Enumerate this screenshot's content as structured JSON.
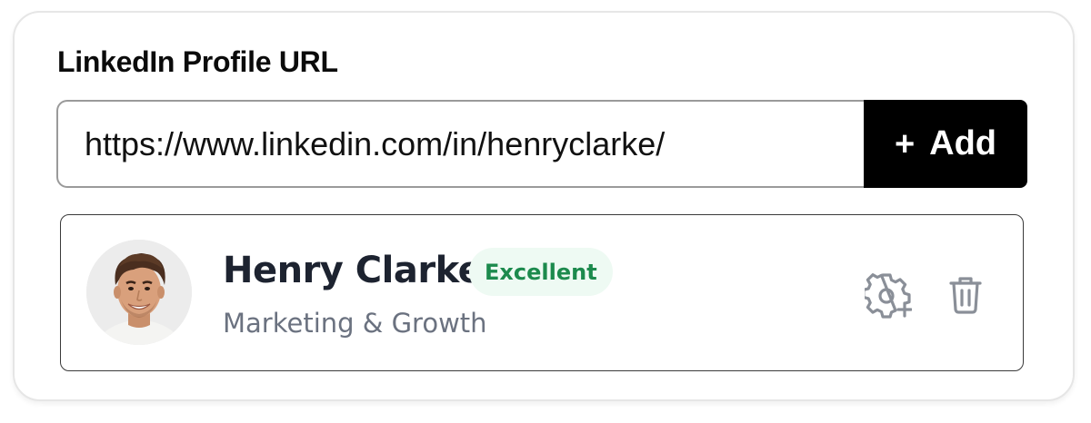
{
  "form": {
    "label": "LinkedIn Profile URL",
    "url_value": "https://www.linkedin.com/in/henryclarke/",
    "add_button": {
      "icon": "plus-icon",
      "icon_glyph": "+",
      "label": "Add"
    }
  },
  "profile": {
    "name": "Henry Clarke",
    "badge": "Excellent",
    "role": "Marketing & Growth",
    "avatar": "avatar-photo",
    "actions": [
      {
        "icon": "gear-plus-icon"
      },
      {
        "icon": "trash-icon"
      }
    ]
  },
  "colors": {
    "badge_text": "#1c8a4d",
    "badge_bg": "#eefaf3",
    "button_bg": "#000000",
    "icon_gray": "#8a8f98"
  }
}
